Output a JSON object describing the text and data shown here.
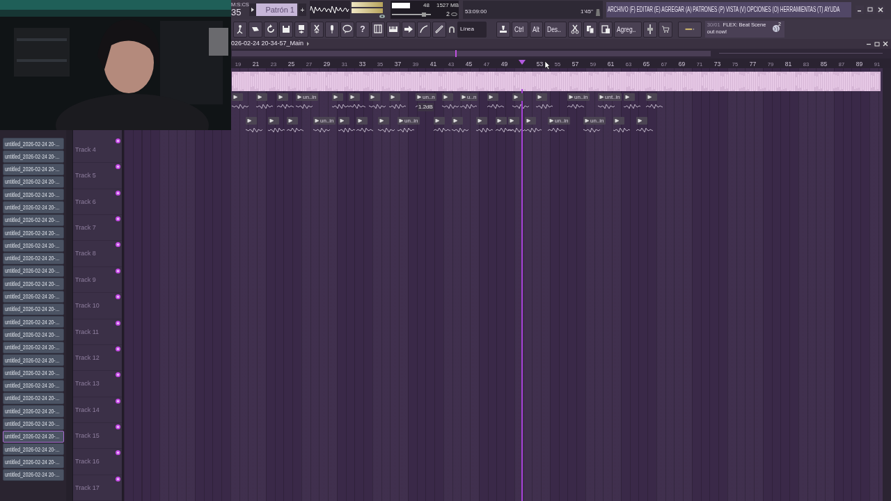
{
  "transport": {
    "time_format": "M:S:CS",
    "counter": "35",
    "pattern": "Patrón 1",
    "add": "+"
  },
  "monitor": {
    "cpu": "48",
    "memory": "1527 MB",
    "polyphony": "2",
    "volume": {
      "level": 0.85
    },
    "song_time": "53:09:00",
    "duration": "1'45''"
  },
  "menu": [
    "ARCHIVO (F)",
    "EDITAR (E)",
    "AGREGAR (A)",
    "PATRONES (P)",
    "VISTA (V)",
    "OPCIONES (O)",
    "HERRAMIENTAS (T)",
    "AYUDA"
  ],
  "toolbar": {
    "help": "?",
    "snap": "Línea",
    "keys": [
      "Ctrl",
      "Alt",
      "Des.."
    ],
    "add": "Agreg.."
  },
  "news": {
    "date": "30/01",
    "text": "FLEX: Beat Scene out now!",
    "badge": "2"
  },
  "playlist": {
    "title": "026-02-24 20-34-57_Main",
    "ruler": [
      {
        "label": "19"
      },
      {
        "label": "21"
      },
      {
        "label": "23"
      },
      {
        "label": "25"
      },
      {
        "label": "27"
      },
      {
        "label": "29"
      },
      {
        "label": "31"
      },
      {
        "label": "33"
      },
      {
        "label": "35"
      },
      {
        "label": "37"
      },
      {
        "label": "39"
      },
      {
        "label": "41"
      },
      {
        "label": "43"
      },
      {
        "label": "45"
      },
      {
        "label": "47"
      },
      {
        "label": "49"
      },
      {
        "kind": "marker"
      },
      {
        "label": "53"
      },
      {
        "label": "55"
      },
      {
        "label": "57"
      },
      {
        "label": "59"
      },
      {
        "label": "61"
      },
      {
        "label": "63"
      },
      {
        "label": "65"
      },
      {
        "label": "67"
      },
      {
        "label": "69"
      },
      {
        "label": "71"
      },
      {
        "label": "73"
      },
      {
        "label": "75"
      },
      {
        "label": "77"
      },
      {
        "label": "79"
      },
      {
        "label": "81"
      },
      {
        "label": "83"
      },
      {
        "label": "85"
      },
      {
        "label": "87"
      },
      {
        "label": "89"
      },
      {
        "label": "91"
      }
    ],
    "lanes": [
      {
        "clips": [
          {
            "kind": "plain"
          },
          {
            "kind": "plain"
          },
          {
            "kind": "plain"
          },
          {
            "kind": "labeled",
            "label": "un..in"
          },
          {
            "kind": "plain"
          },
          {
            "kind": "plain"
          },
          {
            "kind": "plain"
          },
          {
            "kind": "plain"
          },
          {
            "kind": "labeled",
            "label": "un..n"
          },
          {
            "kind": "plain"
          },
          {
            "kind": "labeled",
            "label": "u..n"
          },
          {
            "kind": "plain"
          },
          {
            "kind": "plain"
          },
          {
            "kind": "plain"
          },
          {
            "kind": "labeled",
            "label": "un..in"
          },
          {
            "kind": "labeled",
            "label": "unt..in"
          },
          {
            "kind": "plain"
          },
          {
            "kind": "plain"
          }
        ],
        "gain": "1.2dB"
      },
      {
        "clips": [
          {
            "kind": "plain"
          },
          {
            "kind": "plain"
          },
          {
            "kind": "plain"
          },
          {
            "kind": "labeled",
            "label": "un..in"
          },
          {
            "kind": "plain"
          },
          {
            "kind": "plain"
          },
          {
            "kind": "plain"
          },
          {
            "kind": "labeled",
            "label": "un..in"
          },
          {
            "kind": "plain"
          },
          {
            "kind": "plain"
          },
          {
            "kind": "plain"
          },
          {
            "kind": "plain"
          },
          {
            "kind": "plain"
          },
          {
            "kind": "plain"
          },
          {
            "kind": "labeled",
            "label": "un..in"
          },
          {
            "kind": "labeled",
            "label": "un..in"
          },
          {
            "kind": "plain"
          },
          {
            "kind": "plain"
          }
        ]
      }
    ],
    "tracks": [
      "Track 4",
      "Track 5",
      "Track 6",
      "Track 7",
      "Track 8",
      "Track 9",
      "Track 10",
      "Track 11",
      "Track 12",
      "Track 13",
      "Track 14",
      "Track 15",
      "Track 16",
      "Track 17"
    ]
  },
  "browser": [
    {
      "label": "untitled_2026-02-24 20-...",
      "selected": false
    },
    {
      "label": "untitled_2026-02-24 20-...",
      "selected": false
    },
    {
      "label": "untitled_2026-02-24 20-...",
      "selected": false
    },
    {
      "label": "untitled_2026-02-24 20-...",
      "selected": false
    },
    {
      "label": "untitled_2026-02-24 20-...",
      "selected": false
    },
    {
      "label": "untitled_2026-02-24 20-...",
      "selected": false
    },
    {
      "label": "untitled_2026-02-24 20-...",
      "selected": false
    },
    {
      "label": "untitled_2026-02-24 20-...",
      "selected": false
    },
    {
      "label": "untitled_2026-02-24 20-...",
      "selected": false
    },
    {
      "label": "untitled_2026-02-24 20-...",
      "selected": false
    },
    {
      "label": "untitled_2026-02-24 20-...",
      "selected": false
    },
    {
      "label": "untitled_2026-02-24 20-...",
      "selected": false
    },
    {
      "label": "untitled_2026-02-24 20-...",
      "selected": false
    },
    {
      "label": "untitled_2026-02-24 20-...",
      "selected": false
    },
    {
      "label": "untitled_2026-02-24 20-...",
      "selected": false
    },
    {
      "label": "untitled_2026-02-24 20-...",
      "selected": false
    },
    {
      "label": "untitled_2026-02-24 20-...",
      "selected": false
    },
    {
      "label": "untitled_2026-02-24 20-...",
      "selected": false
    },
    {
      "label": "untitled_2026-02-24 20-...",
      "selected": false
    },
    {
      "label": "untitled_2026-02-24 20-...",
      "selected": false
    },
    {
      "label": "untitled_2026-02-24 20-...",
      "selected": false
    },
    {
      "label": "untitled_2026-02-24 20-...",
      "selected": false
    },
    {
      "label": "untitled_2026-02-24 20-...",
      "selected": false
    },
    {
      "label": "untitled_2026-02-24 20-...",
      "selected": true
    },
    {
      "label": "untitled_2026-02-24 20-...",
      "selected": false
    },
    {
      "label": "untitled_2026-02-24 20-...",
      "selected": false
    },
    {
      "label": "untitled_2026-02-24 20-...",
      "selected": false
    }
  ]
}
